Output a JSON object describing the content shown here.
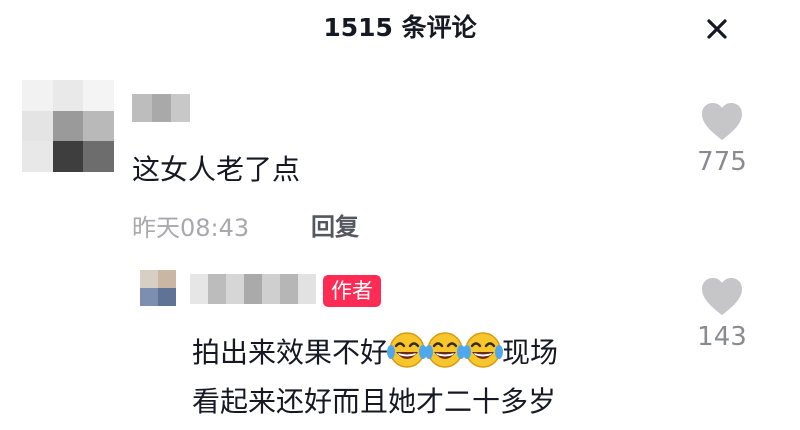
{
  "header": {
    "title": "1515 条评论",
    "close_icon": "close-icon"
  },
  "comments": [
    {
      "text": "这女人老了点",
      "time": "昨天08:43",
      "reply_label": "回复",
      "likes": "775",
      "like_icon": "heart-icon"
    }
  ],
  "reply": {
    "badge": "作者",
    "line1_before": "拍出来效果不好",
    "line1_after": "现场",
    "line2": "看起来还好而且她才二十多岁",
    "emoji_icon": "laughing-tears-emoji",
    "emoji_count": 3,
    "likes": "143",
    "like_icon": "heart-icon"
  },
  "colors": {
    "text": "#161823",
    "meta": "#a8a8ad",
    "badge": "#fe2c55",
    "heart": "#c6c6c9"
  }
}
